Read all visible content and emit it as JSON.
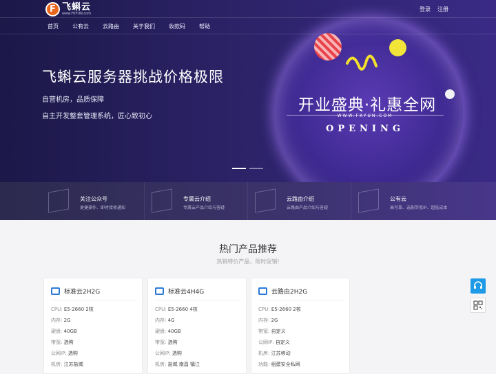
{
  "header": {
    "logo_letter": "F",
    "logo_name": "飞蝌云",
    "logo_url": "www.FKYUN.com",
    "login": "登录",
    "register": "注册"
  },
  "nav": [
    "首页",
    "公有云",
    "云路由",
    "关于我们",
    "收款码",
    "帮助"
  ],
  "hero": {
    "title": "飞蝌云服务器挑战价格极限",
    "line1": "自营机房，品质保障",
    "line2": "自主开发整套管理系统，匠心致初心",
    "promo_title": "开业盛典·礼惠全网",
    "promo_url": "WWW.FKYUN.COM",
    "promo_sub": "OPENING"
  },
  "features": [
    {
      "title": "关注公众号",
      "desc": "更捷操作、即时接收通知",
      "icon": "wechat-box-icon"
    },
    {
      "title": "专属云介绍",
      "desc": "专属云产品介绍与答疑",
      "icon": "server-icon"
    },
    {
      "title": "云路由介绍",
      "desc": "云路由产品介绍与答疑",
      "icon": "router-icon"
    },
    {
      "title": "公有云",
      "desc": "高可靠、选配带宽IP、超低成本",
      "icon": "cloud-icon"
    }
  ],
  "section": {
    "title": "热门产品推荐",
    "subtitle": "热销特价产品，限时促销!"
  },
  "cards": [
    {
      "name": "标准云2H2G",
      "icon": "monitor-icon",
      "specs": [
        {
          "k": "CPU:",
          "v": "E5-2660 2核"
        },
        {
          "k": "内存:",
          "v": "2G"
        },
        {
          "k": "硬盘:",
          "v": "40GB"
        },
        {
          "k": "带宽:",
          "v": "选购"
        },
        {
          "k": "公网IP:",
          "v": "选购"
        },
        {
          "k": "机房:",
          "v": "江苏盐城"
        }
      ]
    },
    {
      "name": "标准云4H4G",
      "icon": "monitor-icon",
      "specs": [
        {
          "k": "CPU:",
          "v": "E5-2660 4核"
        },
        {
          "k": "内存:",
          "v": "4G"
        },
        {
          "k": "硬盘:",
          "v": "40GB"
        },
        {
          "k": "带宽:",
          "v": "选购"
        },
        {
          "k": "公网IP:",
          "v": "选购"
        },
        {
          "k": "机房:",
          "v": "盐城 南昌 镇江"
        }
      ]
    },
    {
      "name": "云路由2H2G",
      "icon": "router-icon",
      "specs": [
        {
          "k": "CPU:",
          "v": "E5-2660 2核"
        },
        {
          "k": "内存:",
          "v": "2G"
        },
        {
          "k": "带宽:",
          "v": "自定义"
        },
        {
          "k": "公网IP:",
          "v": "自定义"
        },
        {
          "k": "机房:",
          "v": "江苏移动"
        },
        {
          "k": "功能:",
          "v": "组建安全私网"
        }
      ]
    }
  ],
  "colors": {
    "brand": "#e9671c",
    "accent": "#2a7ad6",
    "service": "#1e9ae6"
  }
}
